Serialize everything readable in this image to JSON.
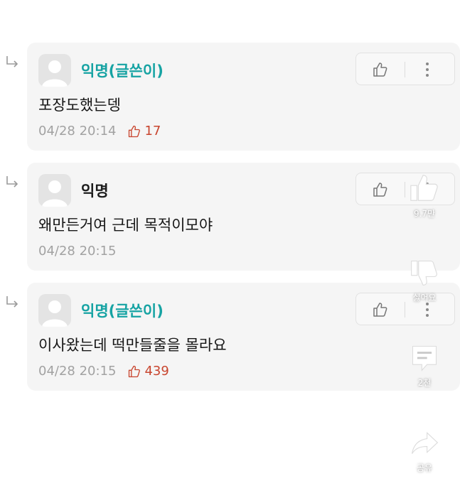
{
  "comments": [
    {
      "nickname": "익명(글쓴이)",
      "is_author": true,
      "text": "포장도했는뎅",
      "timestamp": "04/28 20:14",
      "likes": "17"
    },
    {
      "nickname": "익명",
      "is_author": false,
      "text": "왜만든거여 근데 목적이모야",
      "timestamp": "04/28 20:15",
      "likes": ""
    },
    {
      "nickname": "익명(글쓴이)",
      "is_author": true,
      "text": "이사왔는데 떡만들줄을 몰라요",
      "timestamp": "04/28 20:15",
      "likes": "439"
    }
  ],
  "side_actions": {
    "like_count": "9.7만",
    "dislike_label": "싫어요",
    "comment_count": "2천",
    "share_label": "공유"
  },
  "colors": {
    "author_nick": "#16a3a3",
    "like_count": "#c8452e",
    "card_bg": "#f5f5f5"
  },
  "icons": [
    "reply-arrow-icon",
    "avatar-icon",
    "thumbs-up-icon",
    "more-vertical-icon",
    "thumbs-down-icon",
    "comment-icon",
    "share-icon"
  ]
}
